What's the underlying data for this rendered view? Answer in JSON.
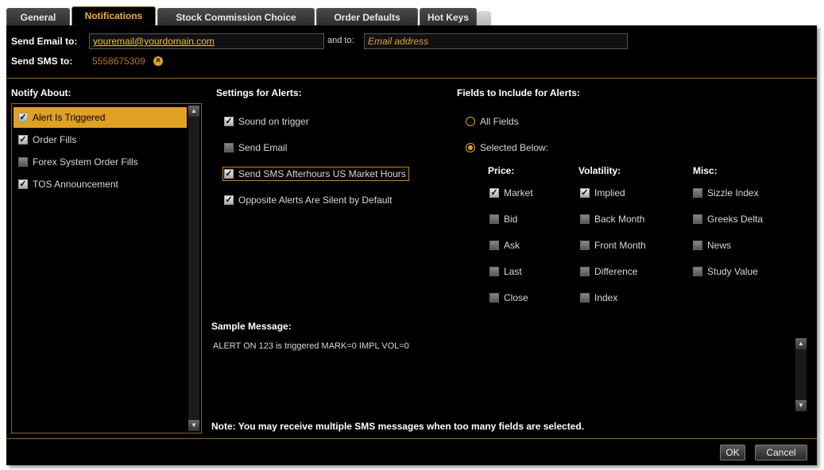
{
  "tabs": [
    {
      "label": "General",
      "active": false
    },
    {
      "label": "Notifications",
      "active": true
    },
    {
      "label": "Stock Commission Choice",
      "active": false
    },
    {
      "label": "Order Defaults",
      "active": false
    },
    {
      "label": "Hot Keys",
      "active": false
    }
  ],
  "email": {
    "label": "Send Email to:",
    "value": "youremail@yourdomain.com",
    "and_to_label": "and to:",
    "and_to_placeholder": "Email address"
  },
  "sms": {
    "label": "Send SMS to:",
    "value": "5558675309"
  },
  "notify_about": {
    "heading": "Notify About:",
    "items": [
      {
        "label": "Alert Is Triggered",
        "checked": true,
        "selected": true
      },
      {
        "label": "Order Fills",
        "checked": true,
        "selected": false
      },
      {
        "label": "Forex System Order Fills",
        "checked": false,
        "selected": false
      },
      {
        "label": "TOS Announcement",
        "checked": true,
        "selected": false
      }
    ]
  },
  "settings": {
    "heading": "Settings for Alerts:",
    "items": [
      {
        "label": "Sound on trigger",
        "checked": true
      },
      {
        "label": "Send Email",
        "checked": false
      },
      {
        "label": "Send SMS Afterhours US Market Hours",
        "checked": true
      },
      {
        "label": "Opposite Alerts Are Silent by Default",
        "checked": true
      }
    ]
  },
  "fields": {
    "heading": "Fields to Include for Alerts:",
    "all_fields": "All Fields",
    "selected_below": "Selected Below:",
    "mode": "selected",
    "price": {
      "heading": "Price:",
      "items": [
        {
          "label": "Market",
          "checked": true
        },
        {
          "label": "Bid",
          "checked": false
        },
        {
          "label": "Ask",
          "checked": false
        },
        {
          "label": "Last",
          "checked": false
        },
        {
          "label": "Close",
          "checked": false
        }
      ]
    },
    "volatility": {
      "heading": "Volatility:",
      "items": [
        {
          "label": "Implied",
          "checked": true
        },
        {
          "label": "Back Month",
          "checked": false
        },
        {
          "label": "Front Month",
          "checked": false
        },
        {
          "label": "Difference",
          "checked": false
        },
        {
          "label": "Index",
          "checked": false
        }
      ]
    },
    "misc": {
      "heading": "Misc:",
      "items": [
        {
          "label": "Sizzle Index",
          "checked": false
        },
        {
          "label": "Greeks Delta",
          "checked": false
        },
        {
          "label": "News",
          "checked": false
        },
        {
          "label": "Study Value",
          "checked": false
        }
      ]
    }
  },
  "sample": {
    "heading": "Sample Message:",
    "text": "ALERT ON 123 is triggered MARK=0 IMPL VOL=0"
  },
  "note": "Note: You may receive multiple SMS messages when too many fields are selected.",
  "buttons": {
    "ok": "OK",
    "cancel": "Cancel"
  },
  "icons": {
    "checkmark": "check-icon",
    "clear": "clear-x-icon",
    "scroll_up": "arrow-up-icon",
    "scroll_down": "arrow-down-icon"
  },
  "colors": {
    "accent": "#e0a020",
    "background": "#000000",
    "text": "#d8d8d8"
  }
}
